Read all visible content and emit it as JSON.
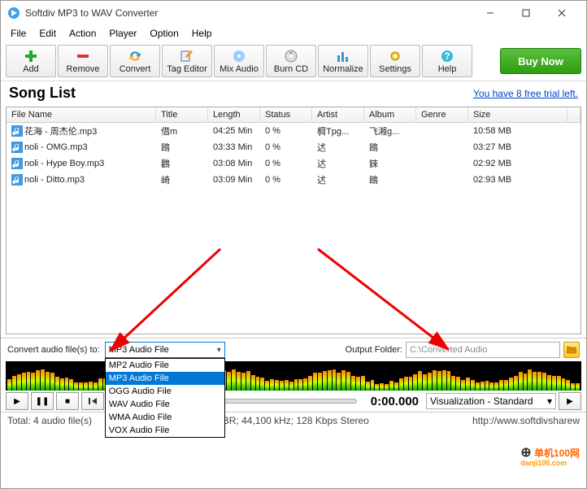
{
  "window": {
    "title": "Softdiv MP3 to WAV Converter"
  },
  "menu": [
    "File",
    "Edit",
    "Action",
    "Player",
    "Option",
    "Help"
  ],
  "toolbar": [
    {
      "label": "Add"
    },
    {
      "label": "Remove"
    },
    {
      "label": "Convert"
    },
    {
      "label": "Tag Editor"
    },
    {
      "label": "Mix Audio"
    },
    {
      "label": "Burn CD"
    },
    {
      "label": "Normalize"
    },
    {
      "label": "Settings"
    },
    {
      "label": "Help"
    }
  ],
  "buy": "Buy Now",
  "songlist_title": "Song List",
  "trial_text": "You have 8 free trial left.",
  "columns": [
    "File Name",
    "Title",
    "Length",
    "Status",
    "Artist",
    "Album",
    "Genre",
    "Size"
  ],
  "rows": [
    {
      "file": "花海 - 周杰伦.mp3",
      "title": "借m",
      "length": "04:25 Min",
      "status": "0 %",
      "artist": "椆Tpg...",
      "album": "飞湘g...",
      "genre": "",
      "size": "10:58 MB"
    },
    {
      "file": "noli - OMG.mp3",
      "title": "鴎",
      "length": "03:33 Min",
      "status": "0 %",
      "artist": "迖",
      "album": "鴎",
      "genre": "",
      "size": "03:27 MB"
    },
    {
      "file": "noli - Hype Boy.mp3",
      "title": "鸛",
      "length": "03:08 Min",
      "status": "0 %",
      "artist": "迖",
      "album": "錸",
      "genre": "",
      "size": "02:92 MB"
    },
    {
      "file": "noli - Ditto.mp3",
      "title": "崎",
      "length": "03:09 Min",
      "status": "0 %",
      "artist": "迖",
      "album": "鴎",
      "genre": "",
      "size": "02:93 MB"
    }
  ],
  "convert_label": "Convert audio file(s) to:",
  "format_selected": "MP3 Audio File",
  "format_options": [
    "MP2 Audio File",
    "MP3 Audio File",
    "OGG Audio File",
    "WAV Audio File",
    "WMA Audio File",
    "VOX Audio File"
  ],
  "output_label": "Output Folder:",
  "output_path": "C:\\Converted Audio",
  "timecode": "0:00.000",
  "vis_selected": "Visualization - Standard",
  "status_total": "Total: 4 audio file(s)",
  "status_quality": "Quality: MP3 CBR; 44,100 kHz; 128 Kbps Stereo",
  "status_url": "http://www.softdivsharew",
  "watermark": "单机100网"
}
